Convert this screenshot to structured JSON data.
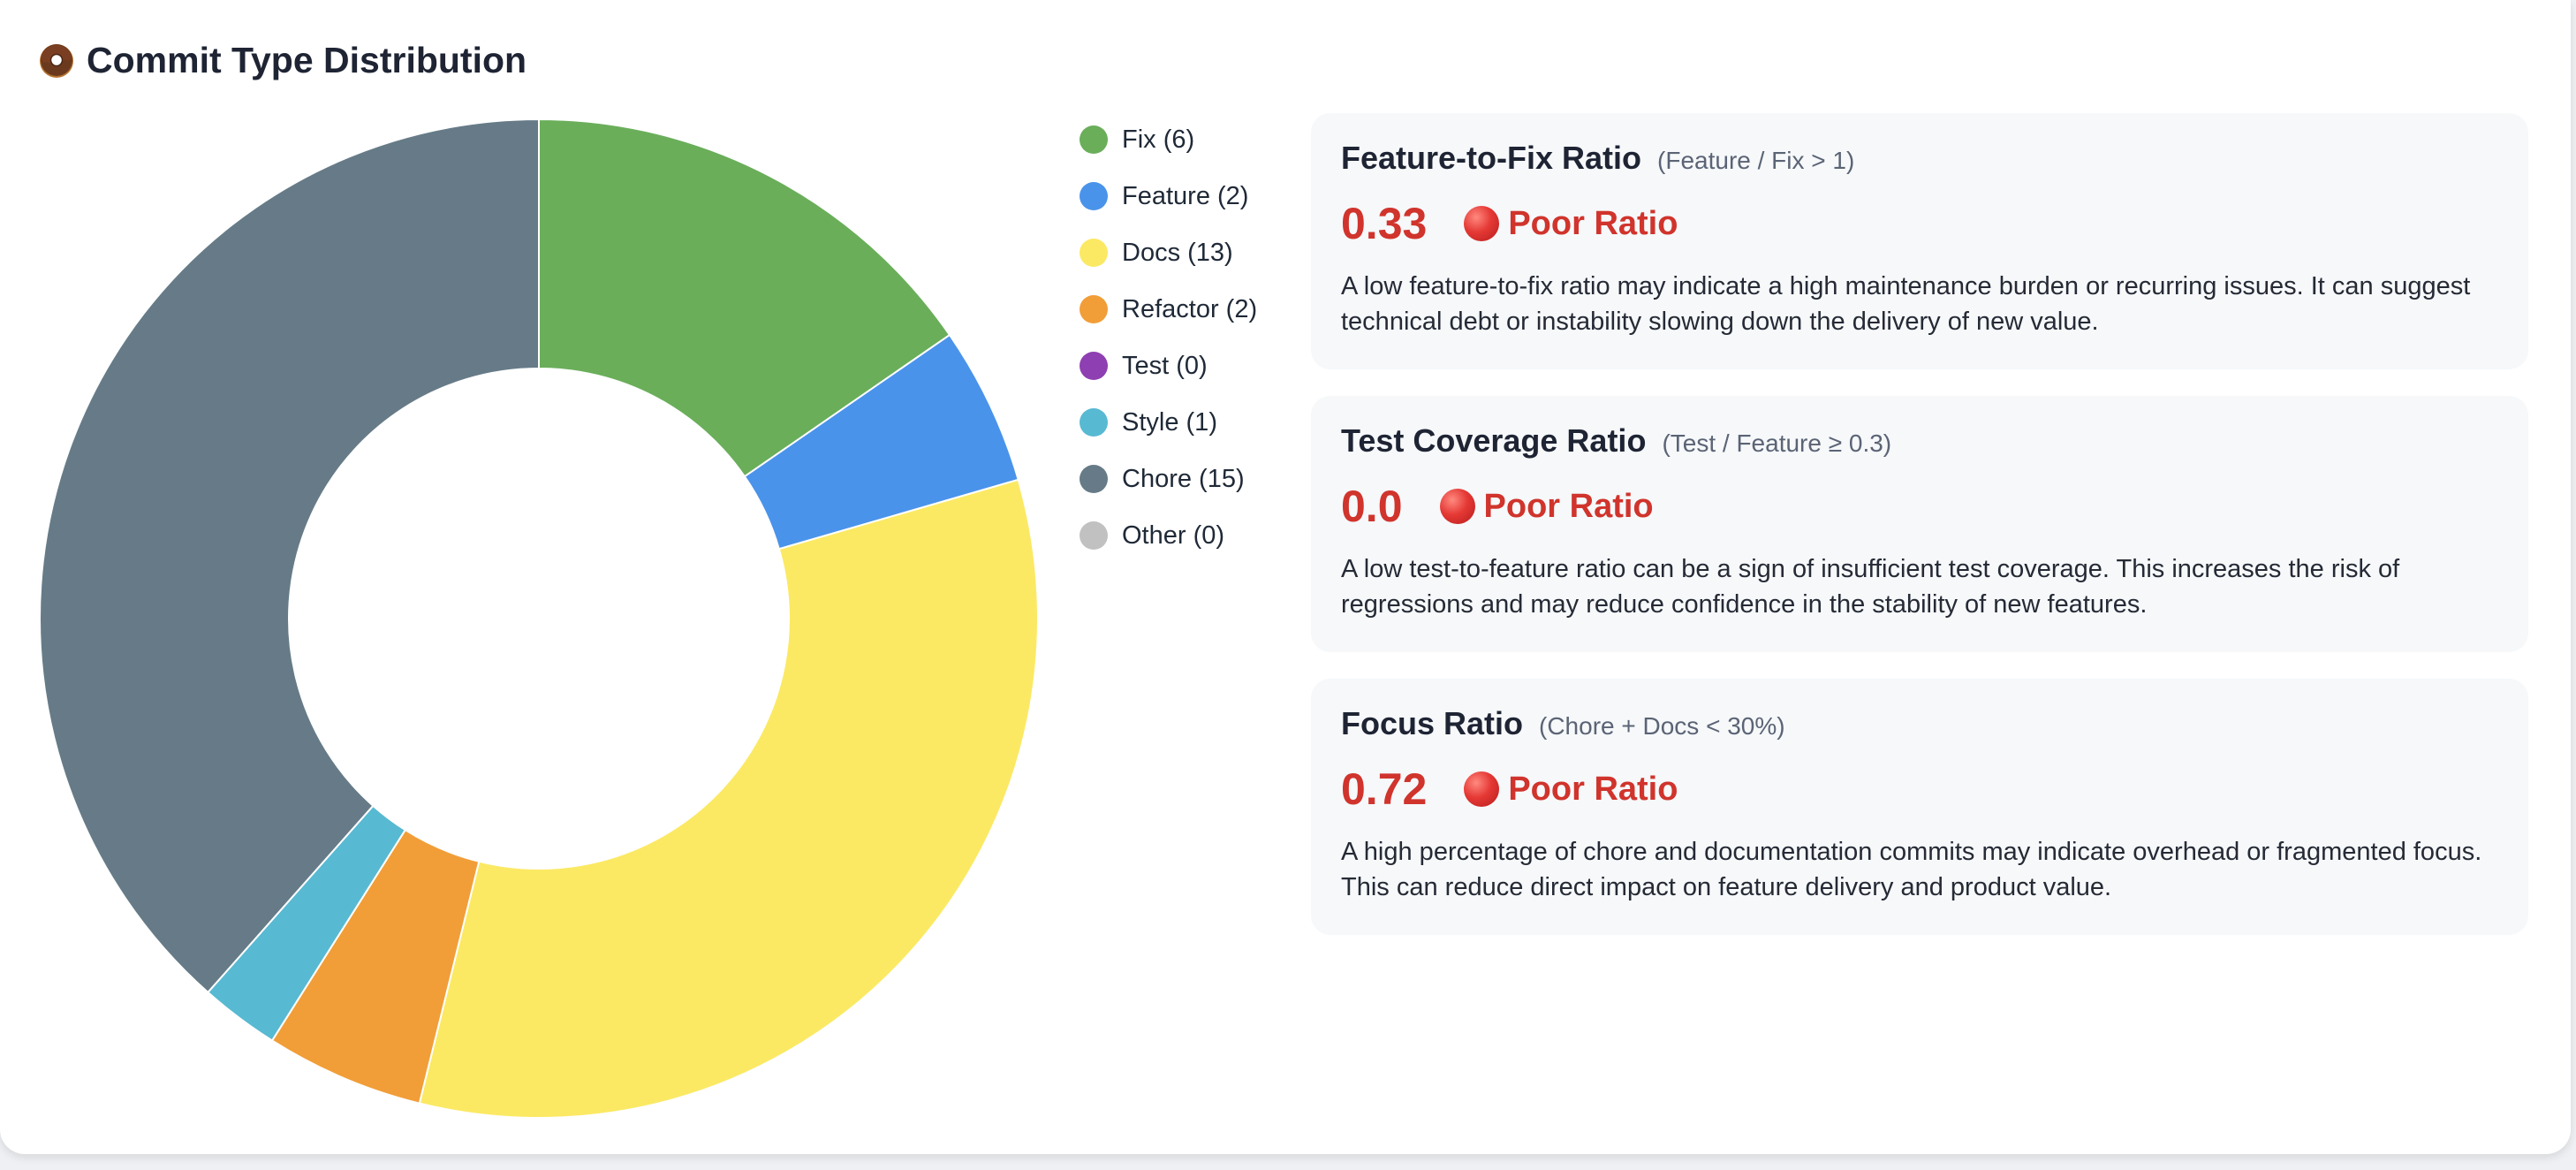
{
  "header": {
    "title": "Commit Type Distribution",
    "icon": "donut-icon"
  },
  "chart_data": {
    "type": "pie",
    "variant": "donut",
    "title": "Commit Type Distribution",
    "categories": [
      "Fix",
      "Feature",
      "Docs",
      "Refactor",
      "Test",
      "Style",
      "Chore",
      "Other"
    ],
    "values": [
      6,
      2,
      13,
      2,
      0,
      1,
      15,
      0
    ],
    "colors": [
      "#6aae5a",
      "#4a93eb",
      "#fbe964",
      "#f19e38",
      "#8e3fb1",
      "#58b9d2",
      "#667b87",
      "#c1c1c1"
    ],
    "legend": {
      "position": "right",
      "labels": [
        "Fix (6)",
        "Feature (2)",
        "Docs (13)",
        "Refactor (2)",
        "Test (0)",
        "Style (1)",
        "Chore (15)",
        "Other (0)"
      ]
    }
  },
  "metrics": [
    {
      "title": "Feature-to-Fix Ratio",
      "rule": "(Feature / Fix > 1)",
      "value": "0.33",
      "status_icon": "red-circle-icon",
      "status": "Poor Ratio",
      "status_color": "#d0342c",
      "description": "A low feature-to-fix ratio may indicate a high maintenance burden or recurring issues. It can suggest technical debt or instability slowing down the delivery of new value."
    },
    {
      "title": "Test Coverage Ratio",
      "rule": "(Test / Feature ≥ 0.3)",
      "value": "0.0",
      "status_icon": "red-circle-icon",
      "status": "Poor Ratio",
      "status_color": "#d0342c",
      "description": "A low test-to-feature ratio can be a sign of insufficient test coverage. This increases the risk of regressions and may reduce confidence in the stability of new features."
    },
    {
      "title": "Focus Ratio",
      "rule": "(Chore + Docs < 30%)",
      "value": "0.72",
      "status_icon": "red-circle-icon",
      "status": "Poor Ratio",
      "status_color": "#d0342c",
      "description": "A high percentage of chore and documentation commits may indicate overhead or fragmented focus. This can reduce direct impact on feature delivery and product value."
    }
  ]
}
